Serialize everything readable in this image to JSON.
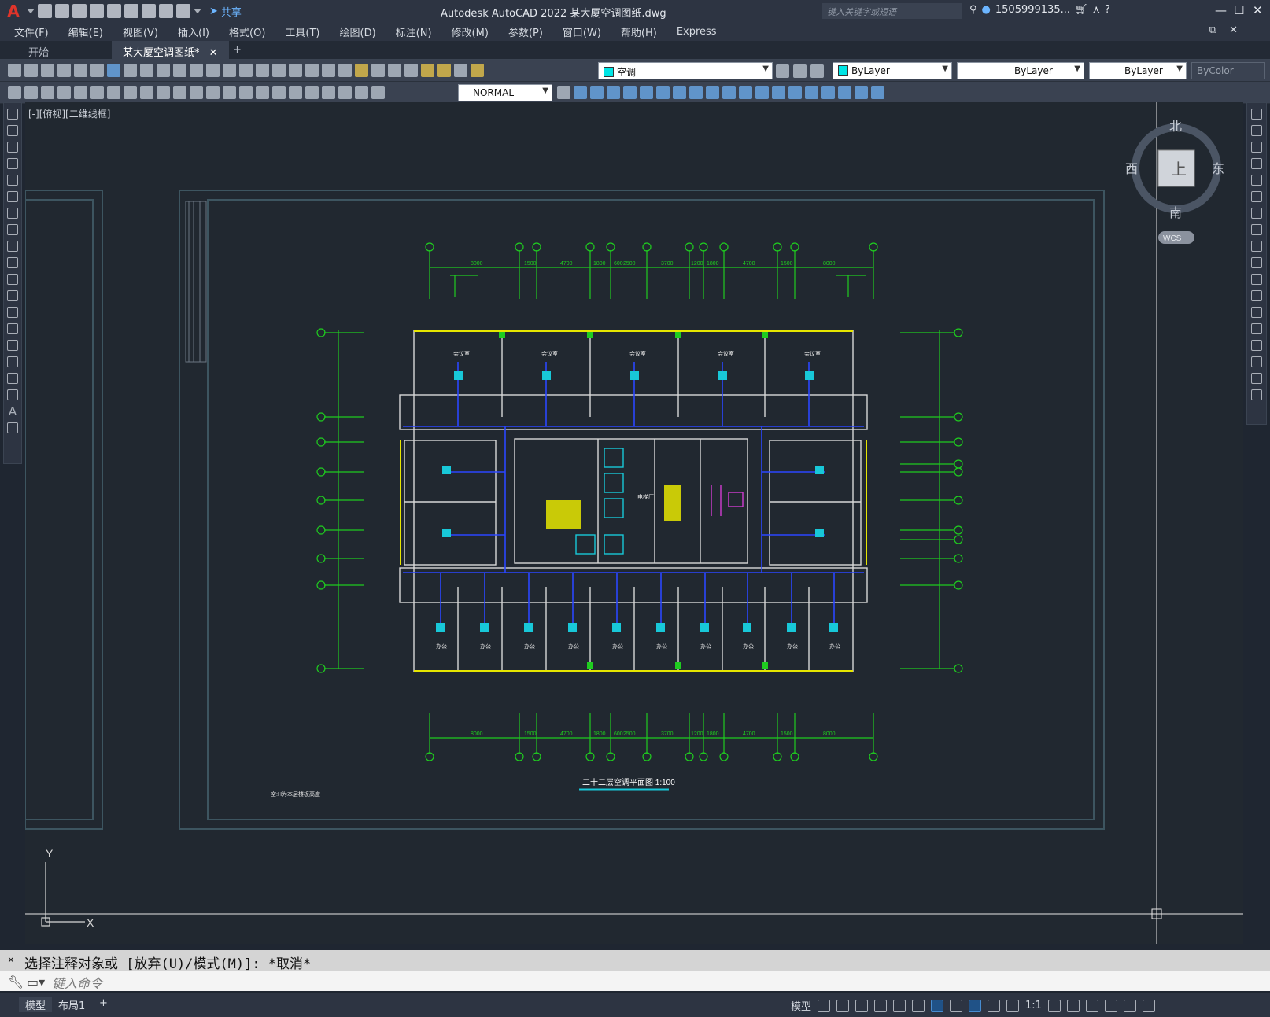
{
  "app": {
    "title": "Autodesk AutoCAD 2022    某大厦空调图纸.dwg",
    "search_placeholder": "键入关键字或短语",
    "user": "1505999135...",
    "share_label": "共享"
  },
  "menus": [
    "文件(F)",
    "编辑(E)",
    "视图(V)",
    "插入(I)",
    "格式(O)",
    "工具(T)",
    "绘图(D)",
    "标注(N)",
    "修改(M)",
    "参数(P)",
    "窗口(W)",
    "帮助(H)",
    "Express"
  ],
  "tabs": [
    {
      "label": "开始",
      "active": false
    },
    {
      "label": "某大厦空调图纸*",
      "active": true
    }
  ],
  "toolbar": {
    "layer": "空调",
    "layer_color": "#00e5e5",
    "color": "ByLayer",
    "linetype": "ByLayer",
    "lineweight": "ByLayer",
    "plotstyle": "ByColor",
    "textstyle": "NORMAL"
  },
  "viewport": {
    "label": "[-][俯视][二维线框]",
    "navcube": {
      "north": "北",
      "south": "南",
      "west": "西",
      "east": "东",
      "top": "上",
      "wcs": "WCS"
    },
    "ucs": {
      "x": "X",
      "y": "Y"
    }
  },
  "drawing": {
    "title": "二十二层空调平面图 1:100",
    "note": "空:H为本层楼板高度",
    "room_office": "办公",
    "room_gen": "会议室",
    "room_elev": "电梯厅",
    "top_dims": [
      "8000",
      "1500",
      "4700",
      "1800",
      "600",
      "2500",
      "3700",
      "1200",
      "1800",
      "4700",
      "1500",
      "8000"
    ],
    "bottom_dims": [
      "8000",
      "1500",
      "4700",
      "1800",
      "600",
      "2500",
      "3700",
      "1200",
      "1800",
      "4700",
      "1500",
      "8000"
    ]
  },
  "command": {
    "history": "选择注释对象或 [放弃(U)/模式(M)]: *取消*",
    "placeholder": "键入命令"
  },
  "status": {
    "tabs": [
      {
        "label": "模型",
        "active": true
      },
      {
        "label": "布局1",
        "active": false
      }
    ],
    "model": "模型",
    "scale": "1:1"
  }
}
